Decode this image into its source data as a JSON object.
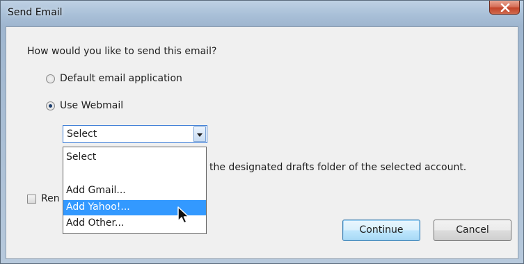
{
  "window": {
    "title": "Send Email",
    "close_label": "x"
  },
  "prompt": "How would you like to send this email?",
  "options": [
    {
      "label": "Default email application",
      "checked": false
    },
    {
      "label": "Use Webmail",
      "checked": true
    }
  ],
  "account_select": {
    "value": "Select",
    "options": [
      "Select",
      "Add Gmail...",
      "Add Yahoo!...",
      "Add Other..."
    ],
    "highlighted": "Add Yahoo!..."
  },
  "note": "the designated drafts folder of the selected account.",
  "remember_checkbox": {
    "label_visible": "Ren",
    "checked": false
  },
  "buttons": {
    "continue": "Continue",
    "cancel": "Cancel"
  },
  "colors": {
    "selection": "#3399ff",
    "default_button": "#bee6fd",
    "close_button": "#c3442a"
  }
}
